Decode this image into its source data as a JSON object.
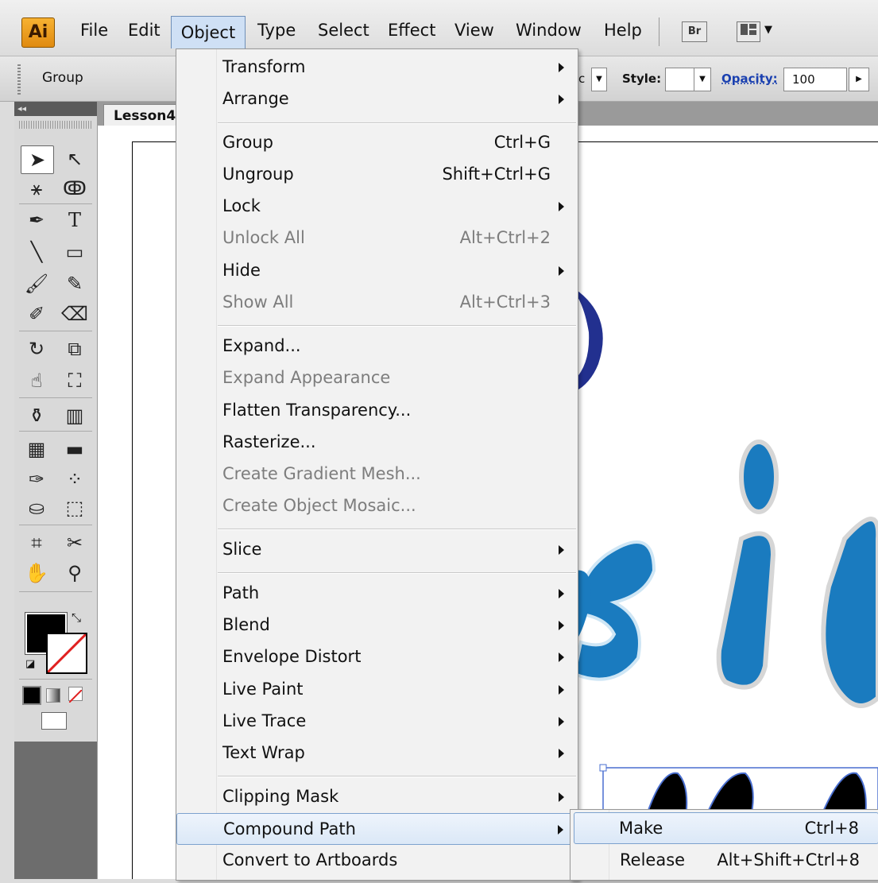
{
  "menubar": {
    "logo": "Ai",
    "items": [
      "File",
      "Edit",
      "Object",
      "Type",
      "Select",
      "Effect",
      "View",
      "Window",
      "Help"
    ],
    "bridge_icon": "Br"
  },
  "controlbar": {
    "group_label": "Group",
    "style_label": "Style:",
    "opacity_label": "Opacity:",
    "opacity_value": "100",
    "partial_c": "c"
  },
  "document": {
    "tab_label": "Lesson4"
  },
  "tools": {
    "icons": [
      "selection-tool",
      "direct-selection-tool",
      "magic-wand-tool",
      "lasso-tool",
      "pen-tool",
      "type-tool",
      "line-tool",
      "rectangle-tool",
      "paintbrush-tool",
      "pencil-tool",
      "blob-brush-tool",
      "eraser-tool",
      "rotate-tool",
      "scale-tool",
      "warp-tool",
      "free-transform-tool",
      "symbol-sprayer-tool",
      "column-graph-tool",
      "mesh-tool",
      "gradient-tool",
      "eyedropper-tool",
      "blend-tool",
      "live-paint-bucket-tool",
      "live-paint-selection-tool",
      "artboard-tool",
      "slice-tool",
      "hand-tool",
      "zoom-tool"
    ]
  },
  "object_menu": {
    "sections": [
      [
        {
          "label": "Transform",
          "submenu": true
        },
        {
          "label": "Arrange",
          "submenu": true
        }
      ],
      [
        {
          "label": "Group",
          "shortcut": "Ctrl+G"
        },
        {
          "label": "Ungroup",
          "shortcut": "Shift+Ctrl+G"
        },
        {
          "label": "Lock",
          "submenu": true
        },
        {
          "label": "Unlock All",
          "shortcut": "Alt+Ctrl+2",
          "disabled": true
        },
        {
          "label": "Hide",
          "submenu": true
        },
        {
          "label": "Show All",
          "shortcut": "Alt+Ctrl+3",
          "disabled": true
        }
      ],
      [
        {
          "label": "Expand..."
        },
        {
          "label": "Expand Appearance",
          "disabled": true
        },
        {
          "label": "Flatten Transparency..."
        },
        {
          "label": "Rasterize..."
        },
        {
          "label": "Create Gradient Mesh...",
          "disabled": true
        },
        {
          "label": "Create Object Mosaic...",
          "disabled": true
        }
      ],
      [
        {
          "label": "Slice",
          "submenu": true
        }
      ],
      [
        {
          "label": "Path",
          "submenu": true
        },
        {
          "label": "Blend",
          "submenu": true
        },
        {
          "label": "Envelope Distort",
          "submenu": true
        },
        {
          "label": "Live Paint",
          "submenu": true
        },
        {
          "label": "Live Trace",
          "submenu": true
        },
        {
          "label": "Text Wrap",
          "submenu": true
        }
      ],
      [
        {
          "label": "Clipping Mask",
          "submenu": true
        },
        {
          "label": "Compound Path",
          "submenu": true,
          "highlighted": true
        },
        {
          "label": "Convert to Artboards"
        }
      ]
    ]
  },
  "compound_path_submenu": {
    "items": [
      {
        "label": "Make",
        "shortcut": "Ctrl+8",
        "highlighted": true
      },
      {
        "label": "Release",
        "shortcut": "Alt+Shift+Ctrl+8"
      }
    ]
  },
  "colors": {
    "menu_highlight": "#dbe8f7",
    "artwork_blue": "#1a7bbf",
    "artwork_dark_blue": "#22308f",
    "logo_orange": "#f2a024"
  }
}
